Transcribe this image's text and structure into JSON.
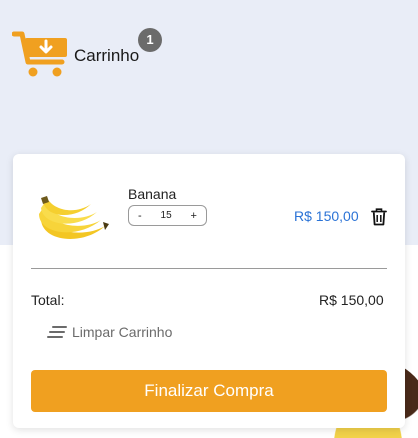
{
  "header": {
    "title": "Carrinho",
    "badge_count": "1",
    "cart_icon": "cart-download-icon"
  },
  "cart": {
    "items": [
      {
        "name": "Banana",
        "quantity": "15",
        "decrement_label": "-",
        "increment_label": "+",
        "price": "R$ 150,00",
        "image": "banana-image"
      }
    ],
    "total_label": "Total:",
    "total_value": "R$ 150,00",
    "clear_label": "Limpar Carrinho",
    "checkout_label": "Finalizar Compra"
  },
  "colors": {
    "accent": "#f0a020",
    "price": "#2b73d6",
    "badge": "#6b6b6b",
    "background_top": "#e9edf7"
  }
}
